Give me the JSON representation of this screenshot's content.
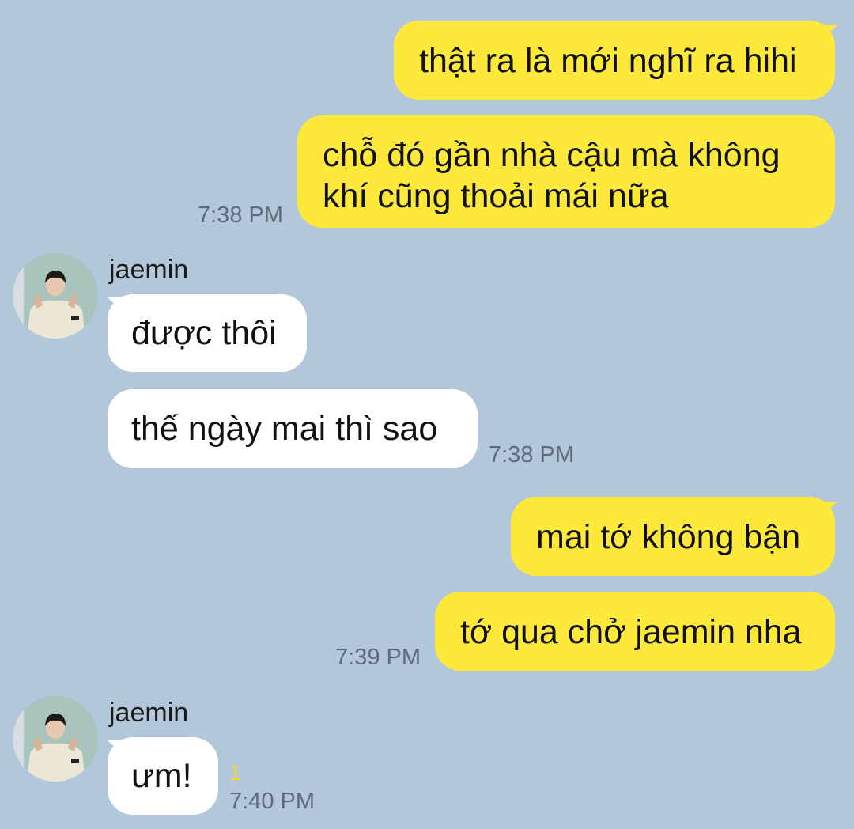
{
  "chat": {
    "messages": [
      {
        "side": "out",
        "text": "thật ra là mới nghĩ ra hihi"
      },
      {
        "side": "out",
        "line1": "chỗ đó gần nhà cậu mà không",
        "line2": "khí cũng thoải mái nữa",
        "time": "7:38 PM"
      },
      {
        "side": "in",
        "sender": "jaemin",
        "text": "được thôi"
      },
      {
        "side": "in",
        "text": "thế ngày mai thì sao",
        "time": "7:38 PM"
      },
      {
        "side": "out",
        "text": "mai tớ không bận"
      },
      {
        "side": "out",
        "text": "tớ qua chở jaemin nha",
        "time": "7:39 PM"
      },
      {
        "side": "in",
        "sender": "jaemin",
        "text": "ưm!",
        "unread": "1",
        "time": "7:40 PM"
      }
    ]
  },
  "colors": {
    "background": "#b2c7da",
    "outgoing_bubble": "#fee93b",
    "incoming_bubble": "#ffffff",
    "unread_count": "#f3d93a"
  }
}
